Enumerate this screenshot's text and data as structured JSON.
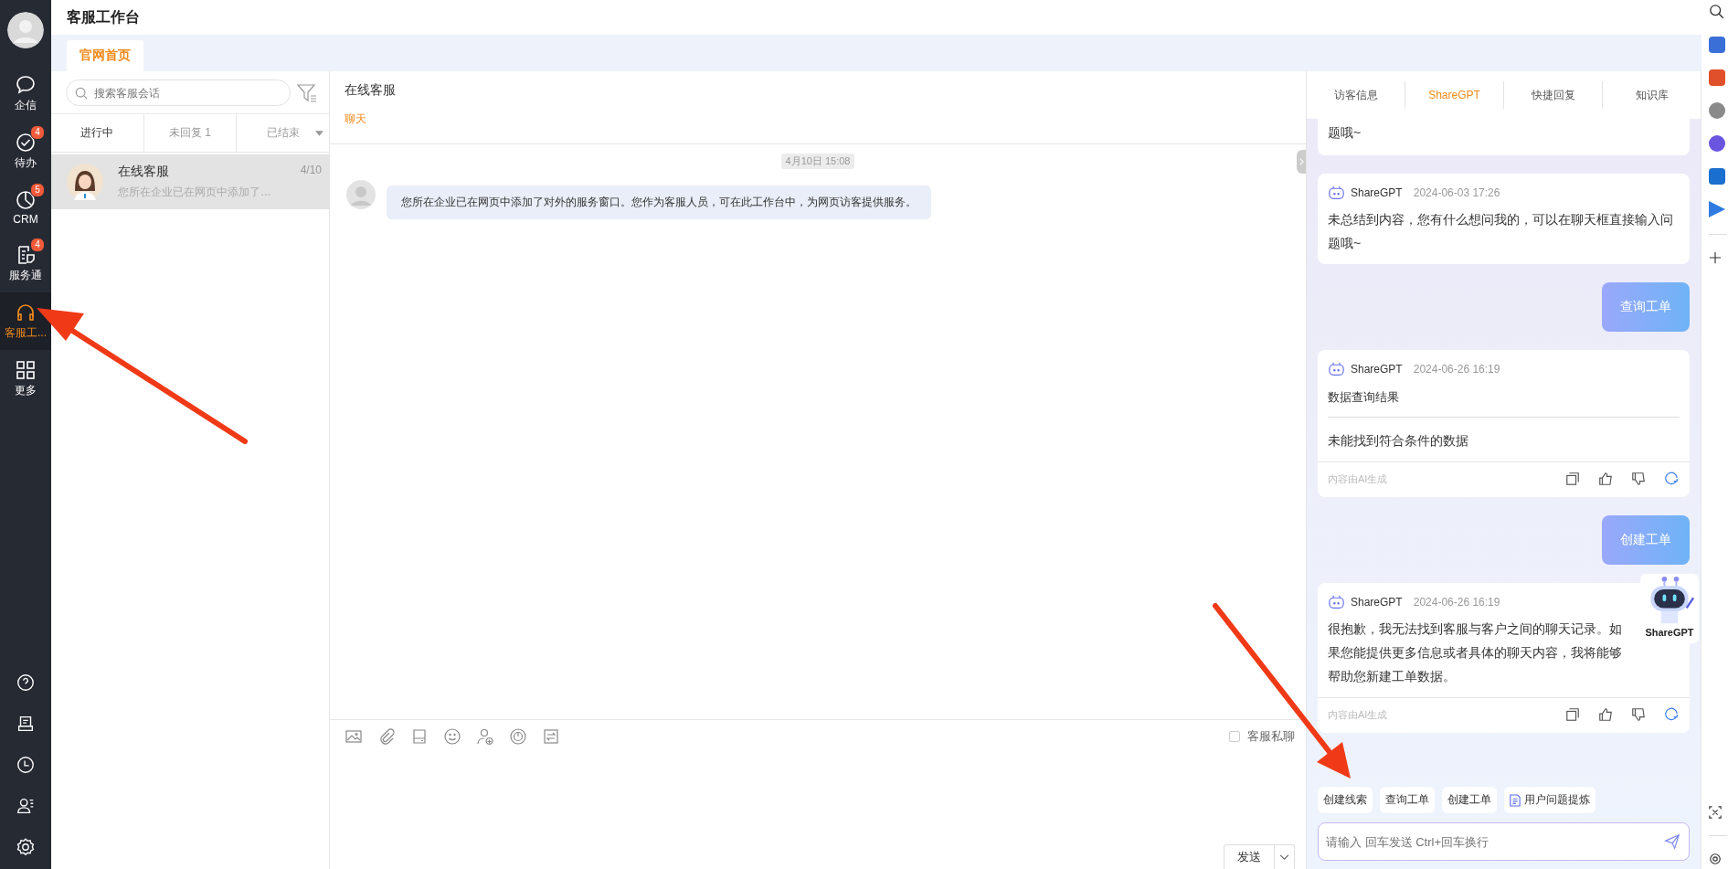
{
  "app_title": "客服工作台",
  "sidebar": {
    "items": [
      {
        "kind": "chat",
        "label": "企信",
        "selected": false
      },
      {
        "kind": "todo",
        "label": "待办",
        "badge": "4",
        "selected": false
      },
      {
        "kind": "crm",
        "label": "CRM",
        "badge": "5",
        "selected": false
      },
      {
        "kind": "service",
        "label": "服务通",
        "badge": "4",
        "selected": false
      },
      {
        "kind": "headset",
        "label": "客服工...",
        "selected": true
      },
      {
        "kind": "grid",
        "label": "更多",
        "selected": false
      }
    ],
    "tools": [
      {
        "kind": "help"
      },
      {
        "kind": "doc"
      },
      {
        "kind": "clock"
      },
      {
        "kind": "contacts"
      },
      {
        "kind": "settings"
      }
    ]
  },
  "page_tabs": [
    {
      "label": "官网首页",
      "selected": true
    }
  ],
  "conversations": {
    "search": {
      "placeholder": "搜索客服会话"
    },
    "tabs": [
      {
        "label": "进行中",
        "selected": true
      },
      {
        "label": "未回复 1",
        "selected": false
      },
      {
        "label": "已结束",
        "selected": false
      }
    ],
    "items": [
      {
        "name": "在线客服",
        "time": "4/10",
        "preview": "您所在企业已在网页中添加了…",
        "selected": true
      }
    ]
  },
  "chat": {
    "title": "在线客服",
    "tabs": [
      {
        "label": "聊天",
        "selected": true
      }
    ],
    "date": "4月10日 15:08",
    "messages": [
      {
        "text": "您所在企业已在网页中添加了对外的服务窗口。您作为客服人员，可在此工作台中，为网页访客提供服务。"
      }
    ],
    "tools": [
      {
        "kind": "image"
      },
      {
        "kind": "clip"
      },
      {
        "kind": "drive"
      },
      {
        "kind": "emoji"
      },
      {
        "kind": "adduser"
      },
      {
        "kind": "power"
      },
      {
        "kind": "swap"
      }
    ],
    "private": {
      "label": "客服私聊",
      "checked": false
    },
    "send": "发送"
  },
  "assistant": {
    "tabs": [
      {
        "label": "访客信息",
        "selected": false
      },
      {
        "label": "ShareGPT",
        "selected": true
      },
      {
        "label": "快捷回复",
        "selected": false
      },
      {
        "label": "知识库",
        "selected": false
      }
    ],
    "messages": [
      {
        "kind": "partial",
        "text": "题哦~"
      },
      {
        "kind": "bot",
        "sender": "ShareGPT",
        "time": "2024-06-03 17:26",
        "text": "未总结到内容，您有什么想问我的，可以在聊天框直接输入问题哦~"
      },
      {
        "kind": "user",
        "text": "查询工单"
      },
      {
        "kind": "bot",
        "sender": "ShareGPT",
        "time": "2024-06-26 16:19",
        "title": "数据查询结果",
        "text": "未能找到符合条件的数据",
        "footer": "内容由AI生成"
      },
      {
        "kind": "user",
        "text": "创建工单"
      },
      {
        "kind": "bot",
        "sender": "ShareGPT",
        "time": "2024-06-26 16:19",
        "text": "很抱歉，我无法找到客服与客户之间的聊天记录。如果您能提供更多信息或者具体的聊天内容，我将能够帮助您新建工单数据。",
        "footer": "内容由AI生成"
      }
    ],
    "chips": [
      {
        "label": "创建线索",
        "kind": "plain"
      },
      {
        "label": "查询工单",
        "kind": "plain"
      },
      {
        "label": "创建工单",
        "kind": "plain"
      },
      {
        "label": "用户问题提炼",
        "kind": "doc"
      }
    ],
    "input": {
      "placeholder": "请输入 回车发送 Ctrl+回车换行"
    },
    "robot_label": "ShareGPT"
  }
}
